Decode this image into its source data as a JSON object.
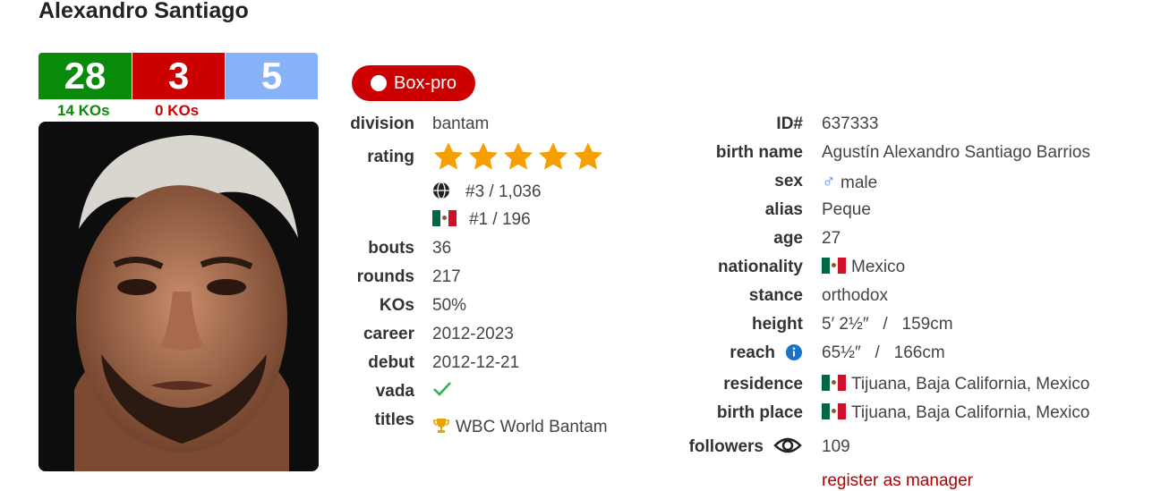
{
  "boxer": {
    "name": "Alexandro Santiago",
    "record": {
      "wins": "28",
      "losses": "3",
      "draws": "5",
      "win_kos": "14 KOs",
      "loss_kos": "0 KOs"
    },
    "badge": "Box-pro",
    "left": {
      "division_label": "division",
      "division": "bantam",
      "rating_label": "rating",
      "world_rank": "#3 / 1,036",
      "country_rank": "#1 / 196",
      "bouts_label": "bouts",
      "bouts": "36",
      "rounds_label": "rounds",
      "rounds": "217",
      "kos_label": "KOs",
      "kos": "50%",
      "career_label": "career",
      "career": "2012-2023",
      "debut_label": "debut",
      "debut": "2012-12-21",
      "vada_label": "vada",
      "titles_label": "titles",
      "titles": "WBC World Bantam"
    },
    "right": {
      "id_label": "ID#",
      "id": "637333",
      "birthname_label": "birth name",
      "birthname": "Agustín Alexandro Santiago Barrios",
      "sex_label": "sex",
      "sex": "male",
      "alias_label": "alias",
      "alias": "Peque",
      "age_label": "age",
      "age": "27",
      "nationality_label": "nationality",
      "nationality": "Mexico",
      "stance_label": "stance",
      "stance": "orthodox",
      "height_label": "height",
      "height": "5′ 2½″   /   159cm",
      "reach_label": "reach",
      "reach": "65½″   /   166cm",
      "residence_label": "residence",
      "residence": "Tijuana, Baja California, Mexico",
      "birthplace_label": "birth place",
      "birthplace": "Tijuana, Baja California, Mexico",
      "followers_label": "followers",
      "followers": "109",
      "register": "register as manager"
    },
    "colors": {
      "win": "#0a8a0a",
      "loss": "#cc0000",
      "draw": "#86b3f7",
      "star": "#f5a000"
    }
  }
}
